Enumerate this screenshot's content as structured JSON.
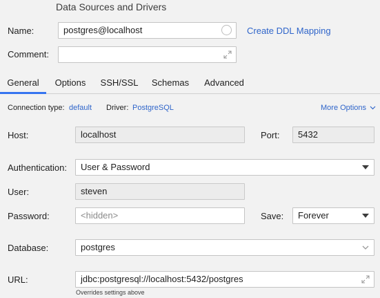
{
  "window": {
    "title": "Data Sources and Drivers"
  },
  "form": {
    "name_label": "Name:",
    "name_value": "postgres@localhost",
    "ddl_link": "Create DDL Mapping",
    "comment_label": "Comment:",
    "comment_value": ""
  },
  "tabs": [
    {
      "label": "General",
      "active": true
    },
    {
      "label": "Options",
      "active": false
    },
    {
      "label": "SSH/SSL",
      "active": false
    },
    {
      "label": "Schemas",
      "active": false
    },
    {
      "label": "Advanced",
      "active": false
    }
  ],
  "connection": {
    "type_label": "Connection type:",
    "type_value": "default",
    "driver_label": "Driver:",
    "driver_value": "PostgreSQL",
    "more_options": "More Options"
  },
  "general": {
    "host_label": "Host:",
    "host_value": "localhost",
    "port_label": "Port:",
    "port_value": "5432",
    "auth_label": "Authentication:",
    "auth_value": "User & Password",
    "user_label": "User:",
    "user_value": "steven",
    "password_label": "Password:",
    "password_placeholder": "<hidden>",
    "save_label": "Save:",
    "save_value": "Forever",
    "database_label": "Database:",
    "database_value": "postgres",
    "url_label": "URL:",
    "url_value": "jdbc:postgresql://localhost:5432/postgres",
    "url_hint": "Overrides settings above"
  },
  "colors": {
    "accent": "#3574f0",
    "link": "#2f65ca",
    "background": "#f2f2f2"
  }
}
